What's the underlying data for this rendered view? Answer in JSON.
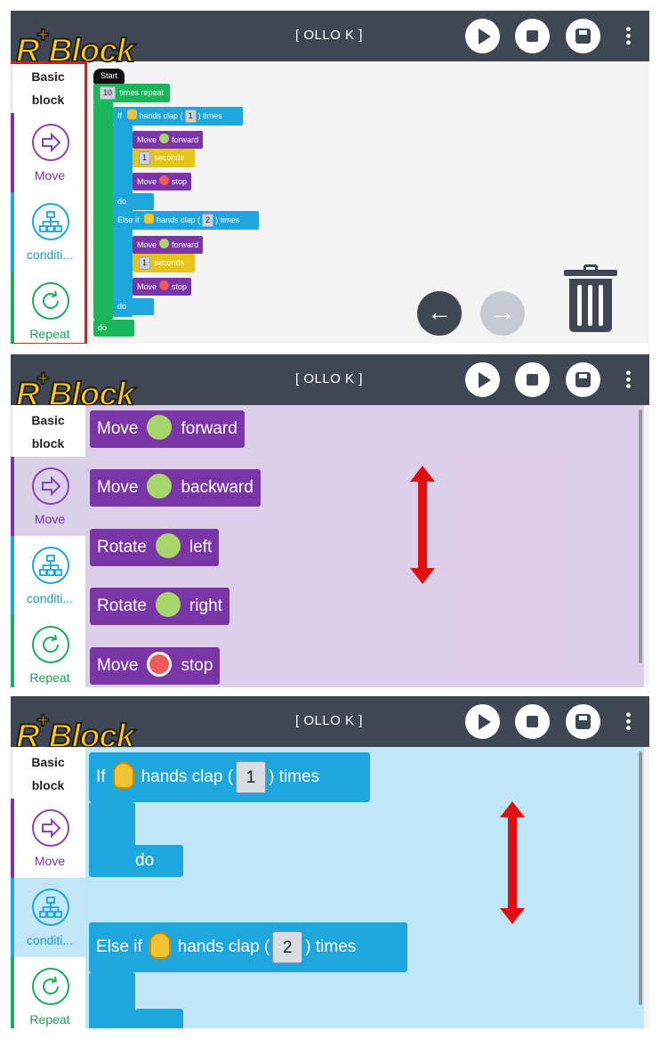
{
  "app": {
    "logo": "R+Block",
    "logo_main": "R",
    "logo_plus": "+",
    "logo_rest": "Block",
    "device": "[ OLLO K ]"
  },
  "categories": {
    "basic": "Basic block",
    "basic_l1": "Basic",
    "basic_l2": "block",
    "move": "Move",
    "conditional": "conditi...",
    "repeat": "Repeat"
  },
  "program": {
    "start": "Start",
    "repeat_count": "10",
    "repeat_label": "times repeat",
    "if_label": "If",
    "clap_label": "hands clap (",
    "times_label": ") times",
    "if_count": "1",
    "else_if_label": "Else if",
    "else_if_count": "2",
    "move_label": "Move",
    "forward": "forward",
    "stop": "stop",
    "seconds_value": "1",
    "seconds_label": "seconds",
    "do_label": "do"
  },
  "move_flyout": [
    {
      "action": "Move",
      "direction": "forward",
      "icon": "up-arrow-icon"
    },
    {
      "action": "Move",
      "direction": "backward",
      "icon": "down-arrow-icon"
    },
    {
      "action": "Rotate",
      "direction": "left",
      "icon": "rotate-left-icon"
    },
    {
      "action": "Rotate",
      "direction": "right",
      "icon": "rotate-right-icon"
    },
    {
      "action": "Move",
      "direction": "stop",
      "icon": "stop-hand-icon"
    }
  ],
  "cond_flyout": {
    "if": {
      "label": "If",
      "clap": "hands clap (",
      "count": "1",
      "times": ") times",
      "do": "do"
    },
    "else_if": {
      "label": "Else if",
      "clap": "hands clap (",
      "count": "2",
      "times": ") times"
    }
  },
  "colors": {
    "header": "#3f4654",
    "move": "#7a35a6",
    "conditional": "#1ea6de",
    "repeat": "#1cae5c",
    "highlight": "#e01b1b"
  }
}
